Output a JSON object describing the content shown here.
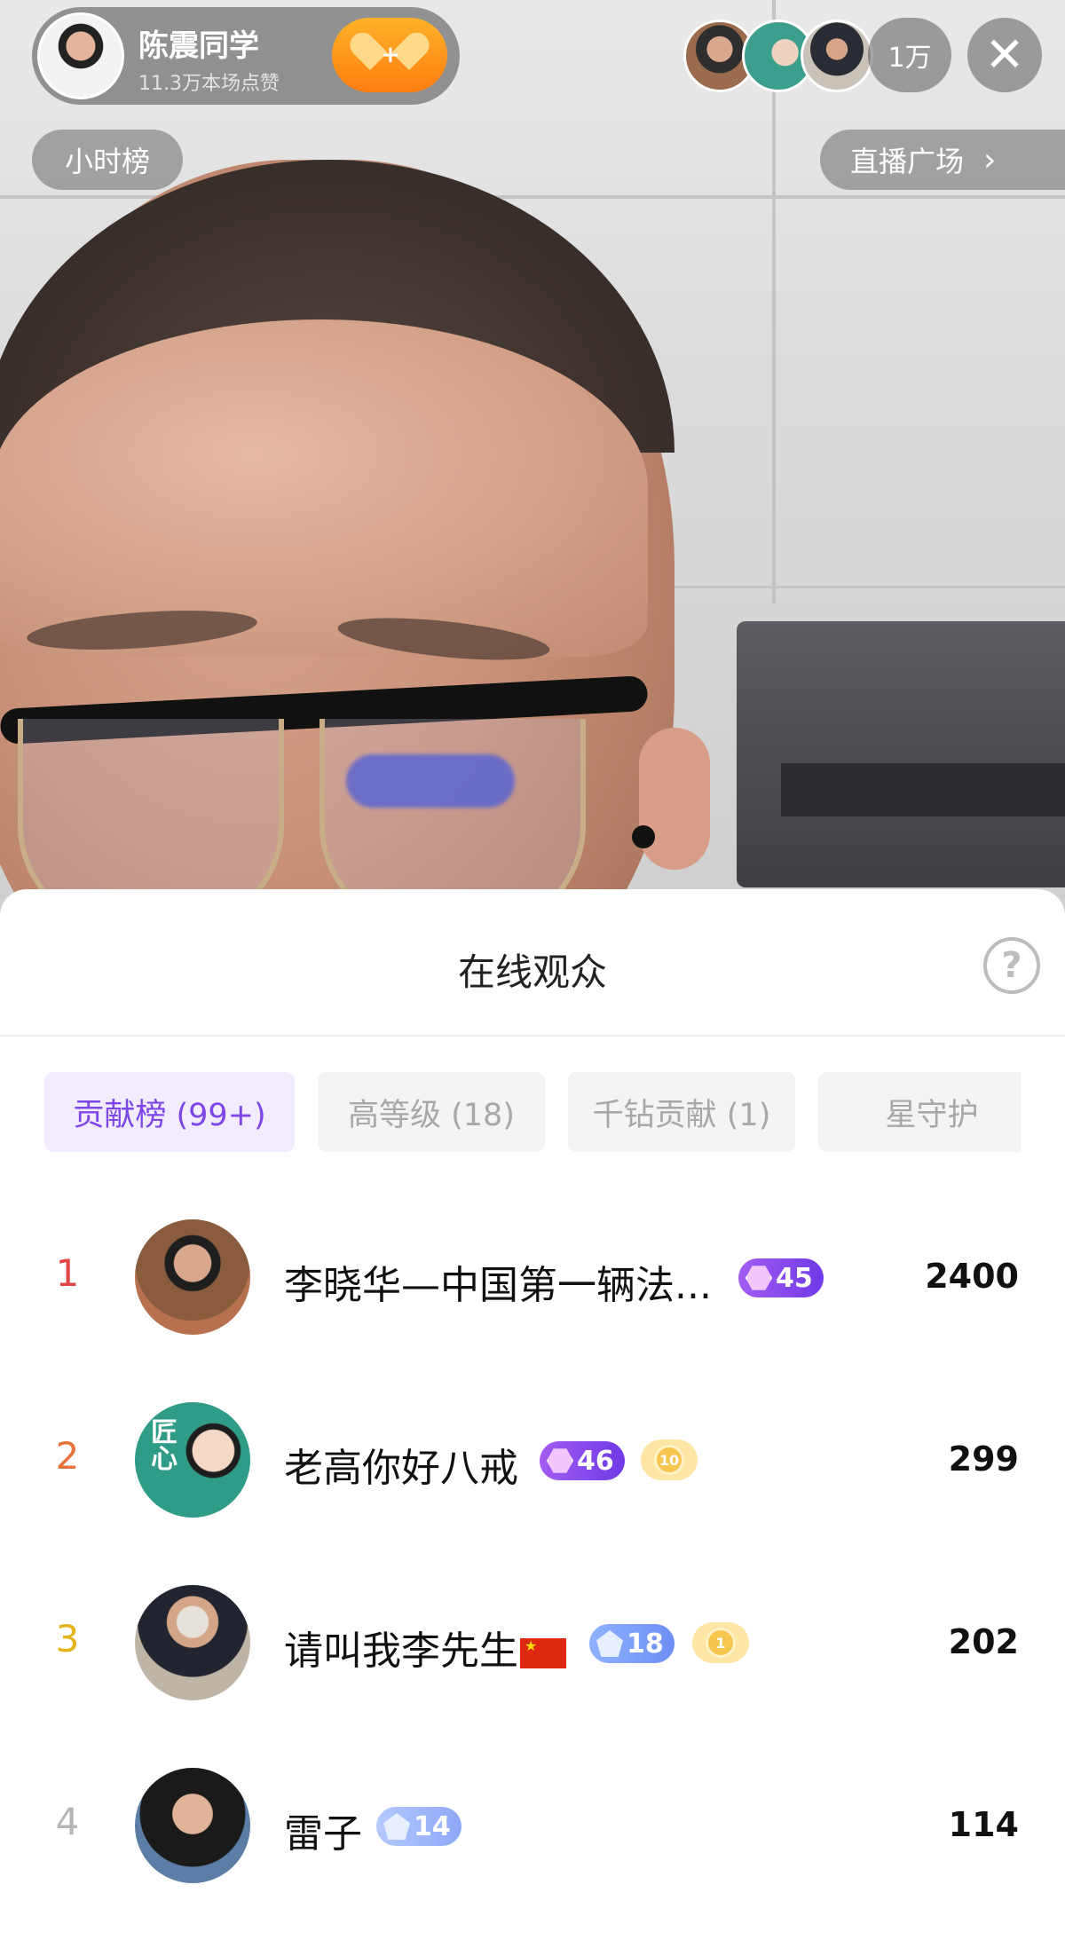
{
  "header": {
    "host_name": "陈震同学",
    "host_likes": "11.3万本场点赞",
    "viewer_count": "1万",
    "close_icon": "close-icon",
    "follow_icon": "heart-plus-icon"
  },
  "nav": {
    "hour_rank": "小时榜",
    "live_square": "直播广场",
    "chevron": "›"
  },
  "panel": {
    "title": "在线观众",
    "help": "?",
    "tabs": [
      {
        "label": "贡献榜 (99+)",
        "active": true
      },
      {
        "label": "高等级 (18)",
        "active": false
      },
      {
        "label": "千钻贡献 (1)",
        "active": false
      },
      {
        "label": "星守护",
        "active": false
      }
    ],
    "rows": [
      {
        "rank": "1",
        "name": "李晓华—中国第一辆法...",
        "level": "45",
        "score": "2400"
      },
      {
        "rank": "2",
        "name": "老高你好八戒",
        "level": "46",
        "fan_level": "10",
        "score": "299"
      },
      {
        "rank": "3",
        "name": "请叫我李先生",
        "level": "18",
        "fan_level": "1",
        "score": "202"
      },
      {
        "rank": "4",
        "name": "雷子",
        "level": "14",
        "score": "114"
      }
    ]
  },
  "colors": {
    "accent": "#7c47e6",
    "rank1": "#e04646",
    "rank2": "#e8733a",
    "rank3": "#e3b41c",
    "rank_other": "#b5b5b5"
  }
}
